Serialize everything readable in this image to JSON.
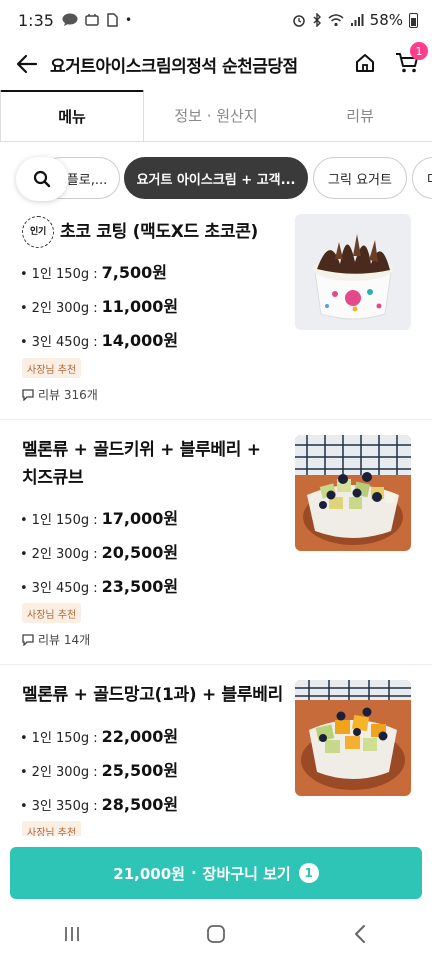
{
  "status": {
    "time": "1:35",
    "battery": "58%"
  },
  "header": {
    "title": "요거트아이스크림의정석 순천금당점",
    "cart_count": "1"
  },
  "tabs": [
    {
      "label": "메뉴"
    },
    {
      "label": "정보 · 원산지"
    },
    {
      "label": "리뷰"
    }
  ],
  "chips": [
    {
      "label": "플로,..."
    },
    {
      "label": "요거트 아이스크림 + 고객..."
    },
    {
      "label": "그릭 요거트"
    },
    {
      "label": "다"
    }
  ],
  "items": [
    {
      "popular_badge": "인기",
      "name": "초코 코팅 (맥도X드 초코콘)",
      "prices": [
        {
          "size": "1인 150g :",
          "price": "7,500원"
        },
        {
          "size": "2인 300g :",
          "price": "11,000원"
        },
        {
          "size": "3인 450g :",
          "price": "14,000원"
        }
      ],
      "badge": "사장님 추천",
      "reviews": "리뷰 316개"
    },
    {
      "name_line1": "멜론류 + 골드키위 + 블루베리 +",
      "name_line2": "치즈큐브",
      "prices": [
        {
          "size": "1인 150g :",
          "price": "17,000원"
        },
        {
          "size": "2인 300g :",
          "price": "20,500원"
        },
        {
          "size": "3인 450g :",
          "price": "23,500원"
        }
      ],
      "badge": "사장님 추천",
      "reviews": "리뷰 14개"
    },
    {
      "name": "멜론류 + 골드망고(1과) + 블루베리",
      "prices": [
        {
          "size": "1인 150g :",
          "price": "22,000원"
        },
        {
          "size": "2인 300g :",
          "price": "25,500원"
        },
        {
          "size": "3인 350g :",
          "price": "28,500원"
        }
      ],
      "badge": "사장님 추천"
    }
  ],
  "cart_bar": {
    "total": "21,000원",
    "separator": "·",
    "label": "장바구니 보기",
    "count": "1"
  },
  "colors": {
    "accent": "#2ec4b6",
    "cart_badge": "#ff3d8b",
    "active_chip": "#3a3a3a"
  }
}
